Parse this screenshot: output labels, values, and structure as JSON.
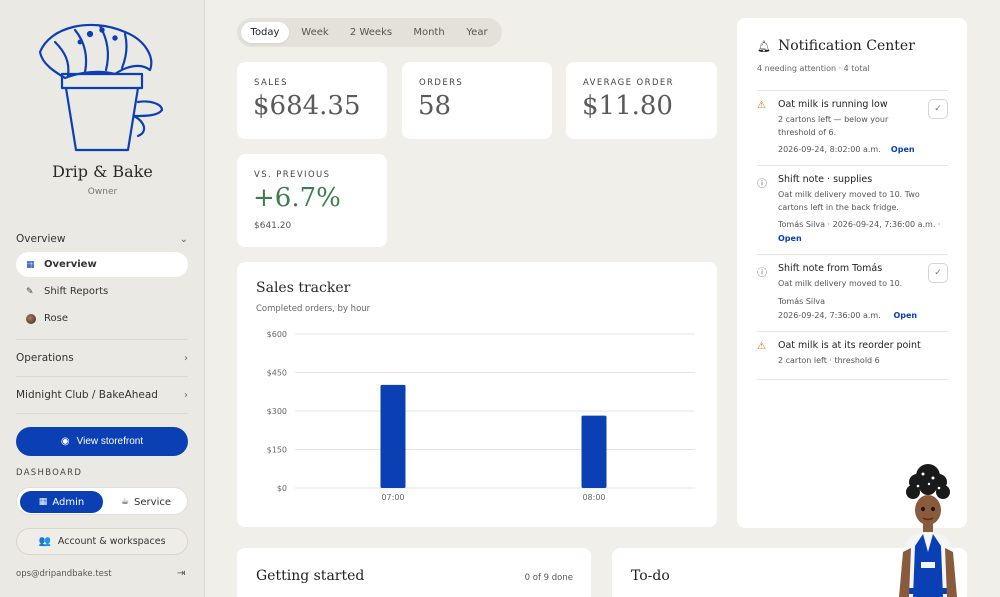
{
  "sidebar": {
    "brand": "Drip & Bake",
    "role": "Owner",
    "overview_group": "Overview",
    "items": [
      {
        "label": "Overview",
        "icon": "grid-icon",
        "active": true
      },
      {
        "label": "Shift Reports",
        "icon": "edit-icon"
      },
      {
        "label": "Rose",
        "icon": "avatar"
      }
    ],
    "operations": "Operations",
    "workspace": "Midnight Club / BakeAhead",
    "storefront_button": "View storefront",
    "dashboard_label": "DASHBOARD",
    "mode_admin": "Admin",
    "mode_service": "Service",
    "account_button": "Account & workspaces",
    "email": "ops@dripandbake.test"
  },
  "range_tabs": [
    "Today",
    "Week",
    "2 Weeks",
    "Month",
    "Year"
  ],
  "range_active": "Today",
  "kpis": {
    "sales": {
      "label": "SALES",
      "value": "$684.35"
    },
    "orders": {
      "label": "ORDERS",
      "value": "58"
    },
    "average": {
      "label": "AVERAGE ORDER",
      "value": "$11.80"
    },
    "previous": {
      "label": "VS. PREVIOUS",
      "value": "+6.7%",
      "sub": "$641.20"
    }
  },
  "sales_tracker": {
    "title": "Sales tracker",
    "subtitle": "Completed orders, by hour"
  },
  "chart_data": {
    "type": "bar",
    "categories": [
      "07:00",
      "08:00"
    ],
    "values": [
      402,
      282
    ],
    "y_ticks": [
      "$0",
      "$150",
      "$300",
      "$450",
      "$600"
    ],
    "ylim": [
      0,
      600
    ],
    "color": "#0b40b5",
    "grid": true
  },
  "notifications": {
    "title": "Notification Center",
    "meta": "4 needing attention · 4 total",
    "items": [
      {
        "type": "warn",
        "title": "Oat milk is running low",
        "body": "2 cartons left — below your threshold of 6.",
        "meta": "2026-09-24, 8:02:00 a.m.",
        "open": "Open",
        "check": true
      },
      {
        "type": "info",
        "title": "Shift note · supplies",
        "body": "Oat milk delivery moved to 10. Two cartons left in the back fridge.",
        "meta": "Tomás Silva  ·  2026-09-24, 7:36:00 a.m.  ·",
        "open": "Open",
        "check": false
      },
      {
        "type": "info",
        "title": "Shift note from Tomás",
        "body": "Oat milk delivery moved to 10.",
        "author": "Tomás Silva",
        "meta": "2026-09-24, 7:36:00 a.m.",
        "open": "Open",
        "check": true
      },
      {
        "type": "warn",
        "title": "Oat milk is at its reorder point",
        "body": "2 carton left · threshold 6",
        "meta": "",
        "open": "",
        "check": false
      }
    ]
  },
  "getting_started": {
    "title": "Getting started",
    "count": "0 of 9 done"
  },
  "todo": {
    "title": "To-do"
  }
}
